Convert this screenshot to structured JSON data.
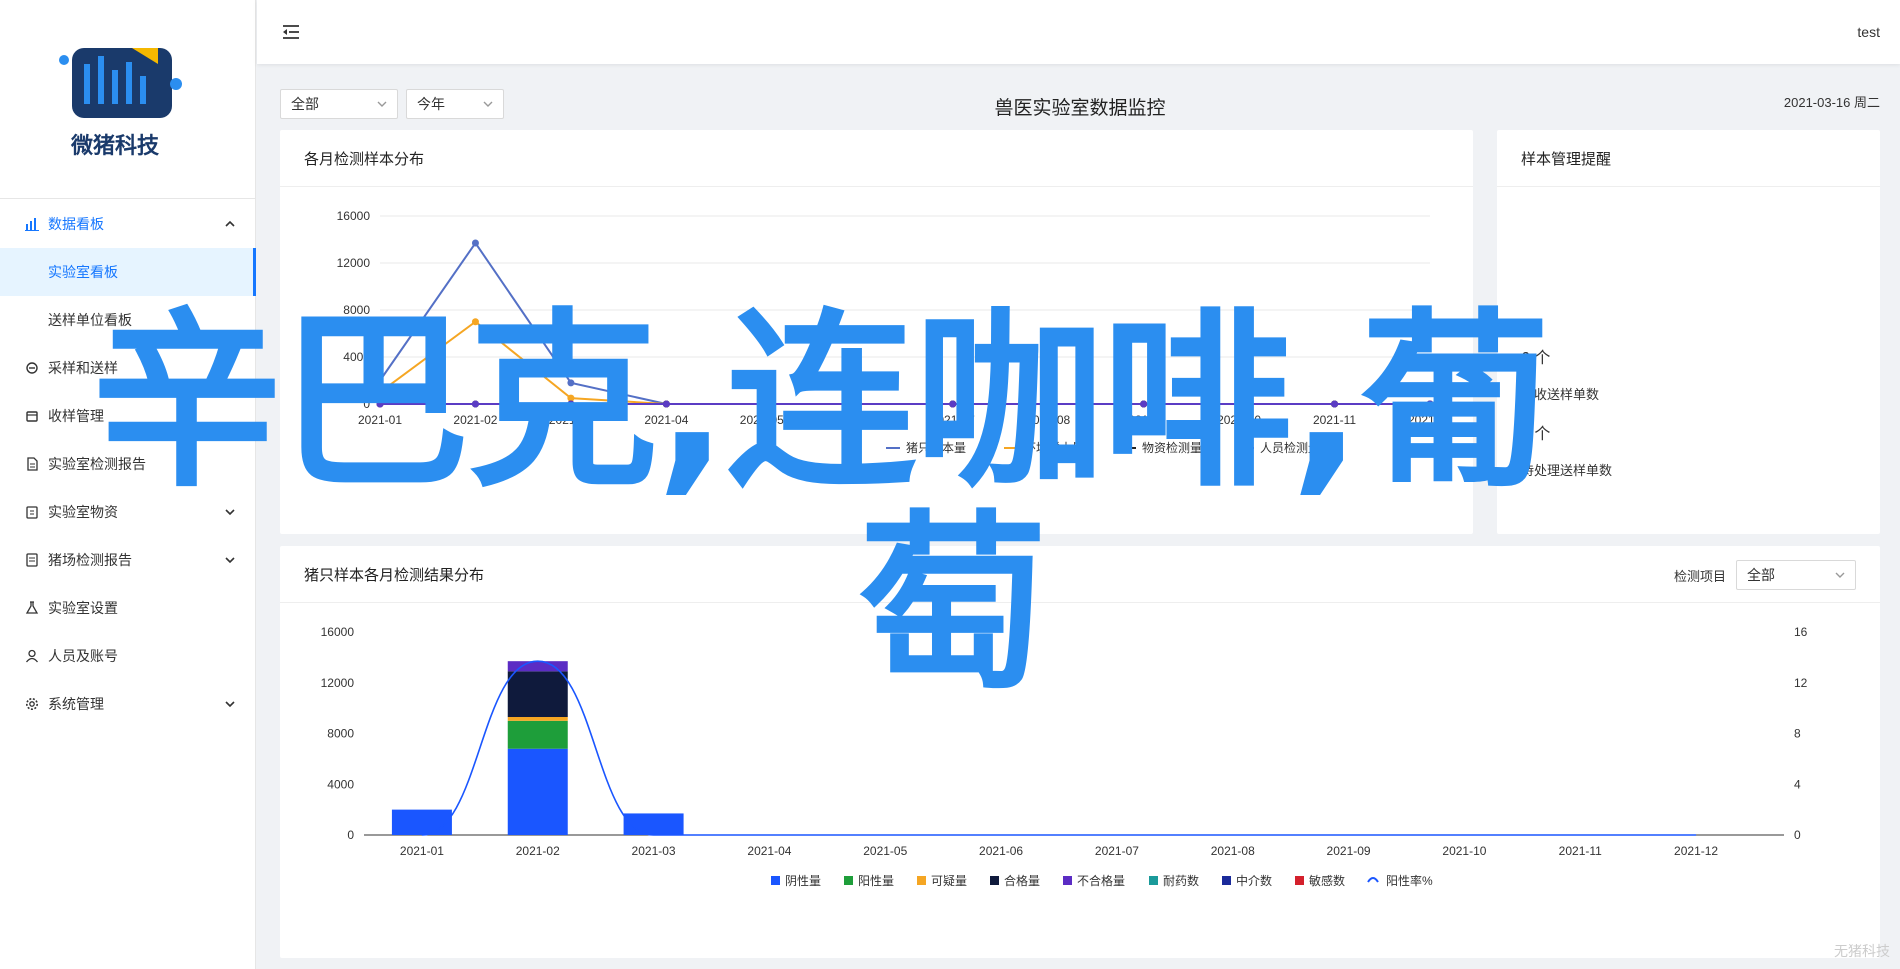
{
  "brand": {
    "name": "微猪科技"
  },
  "header": {
    "user": "test"
  },
  "sidebar": {
    "items": [
      {
        "label": "数据看板",
        "icon": "chart-icon",
        "expanded": true,
        "children": [
          {
            "label": "实验室看板",
            "selected": true
          },
          {
            "label": "送样单位看板"
          }
        ]
      },
      {
        "label": "采样和送样",
        "icon": "sample-icon"
      },
      {
        "label": "收样管理",
        "icon": "box-icon"
      },
      {
        "label": "实验室检测报告",
        "icon": "report-icon"
      },
      {
        "label": "实验室物资",
        "icon": "clipboard-icon",
        "expandable": true
      },
      {
        "label": "猪场检测报告",
        "icon": "doc-icon",
        "expandable": true
      },
      {
        "label": "实验室设置",
        "icon": "flask-icon"
      },
      {
        "label": "人员及账号",
        "icon": "user-icon"
      },
      {
        "label": "系统管理",
        "icon": "gear-icon",
        "expandable": true
      }
    ]
  },
  "toolbar": {
    "scope_select": "全部",
    "period_select": "今年",
    "title": "兽医实验室数据监控",
    "date": "2021-03-16 周二"
  },
  "cards": {
    "monthly": {
      "title": "各月检测样本分布"
    },
    "reminders": {
      "title": "样本管理提醒",
      "stats": [
        {
          "value": "6 个",
          "label": "待收送样单数"
        },
        {
          "value": "2 个",
          "label": "待处理送样单数"
        }
      ]
    },
    "results": {
      "title": "猪只样本各月检测结果分布",
      "filter_label": "检测项目",
      "filter_value": "全部"
    }
  },
  "overlay": {
    "line1": "辛巴克,连咖啡,葡",
    "line2": "萄"
  },
  "watermark": "无猪科技",
  "colors": {
    "primary": "#1677ff",
    "overlay": "#2b8ef0"
  },
  "chart_data": [
    {
      "type": "line",
      "title": "各月检测样本分布",
      "x": [
        "2021-01",
        "2021-02",
        "2021-03",
        "2021-04",
        "2021-05",
        "2021-06",
        "2021-07",
        "2021-08",
        "2021-09",
        "2021-10",
        "2021-11",
        "2021-12"
      ],
      "ylim": [
        0,
        16000
      ],
      "yticks": [
        0,
        4000,
        8000,
        12000,
        16000
      ],
      "legend_position": "bottom",
      "series": [
        {
          "name": "猪只样本量",
          "color": "#5470c6",
          "values": [
            2000,
            13700,
            1800,
            0,
            0,
            0,
            0,
            0,
            0,
            0,
            0,
            0
          ]
        },
        {
          "name": "环境样本量",
          "color": "#f5a623",
          "values": [
            1000,
            7000,
            500,
            0,
            0,
            0,
            0,
            0,
            0,
            0,
            0,
            0
          ]
        },
        {
          "name": "物资检测量",
          "color": "#222222",
          "values": [
            0,
            0,
            0,
            0,
            0,
            0,
            0,
            0,
            0,
            0,
            0,
            0
          ]
        },
        {
          "name": "人员检测量",
          "color": "#5b3cc4",
          "values": [
            0,
            0,
            0,
            0,
            0,
            0,
            0,
            0,
            0,
            0,
            0,
            0
          ]
        }
      ]
    },
    {
      "type": "bar",
      "title": "猪只样本各月检测结果分布",
      "stacked": true,
      "categories": [
        "2021-01",
        "2021-02",
        "2021-03",
        "2021-04",
        "2021-05",
        "2021-06",
        "2021-07",
        "2021-08",
        "2021-09",
        "2021-10",
        "2021-11",
        "2021-12"
      ],
      "ylim": [
        0,
        16000
      ],
      "yticks": [
        0,
        4000,
        8000,
        12000,
        16000
      ],
      "y2lim": [
        0,
        16
      ],
      "y2ticks": [
        0,
        4,
        8,
        12,
        16
      ],
      "legend_position": "bottom",
      "series": [
        {
          "name": "阴性量",
          "color": "#1a56ff",
          "values": [
            2000,
            6800,
            1700,
            0,
            0,
            0,
            0,
            0,
            0,
            0,
            0,
            0
          ]
        },
        {
          "name": "阳性量",
          "color": "#1e9e3a",
          "values": [
            0,
            2200,
            0,
            0,
            0,
            0,
            0,
            0,
            0,
            0,
            0,
            0
          ]
        },
        {
          "name": "可疑量",
          "color": "#f5a623",
          "values": [
            0,
            300,
            0,
            0,
            0,
            0,
            0,
            0,
            0,
            0,
            0,
            0
          ]
        },
        {
          "name": "合格量",
          "color": "#0f1a3c",
          "values": [
            0,
            3600,
            0,
            0,
            0,
            0,
            0,
            0,
            0,
            0,
            0,
            0
          ]
        },
        {
          "name": "不合格量",
          "color": "#5b2cc4",
          "values": [
            0,
            800,
            0,
            0,
            0,
            0,
            0,
            0,
            0,
            0,
            0,
            0
          ]
        },
        {
          "name": "耐药数",
          "color": "#1a9a9a",
          "values": [
            0,
            0,
            0,
            0,
            0,
            0,
            0,
            0,
            0,
            0,
            0,
            0
          ]
        },
        {
          "name": "中介数",
          "color": "#1a2a9a",
          "values": [
            0,
            0,
            0,
            0,
            0,
            0,
            0,
            0,
            0,
            0,
            0,
            0
          ]
        },
        {
          "name": "敏感数",
          "color": "#d4202c",
          "values": [
            0,
            0,
            0,
            0,
            0,
            0,
            0,
            0,
            0,
            0,
            0,
            0
          ]
        }
      ],
      "line_series": {
        "name": "阳性率%",
        "color": "#1a56ff",
        "axis": "right",
        "values": [
          0,
          13.7,
          0,
          0,
          0,
          0,
          0,
          0,
          0,
          0,
          0,
          0
        ]
      }
    }
  ]
}
